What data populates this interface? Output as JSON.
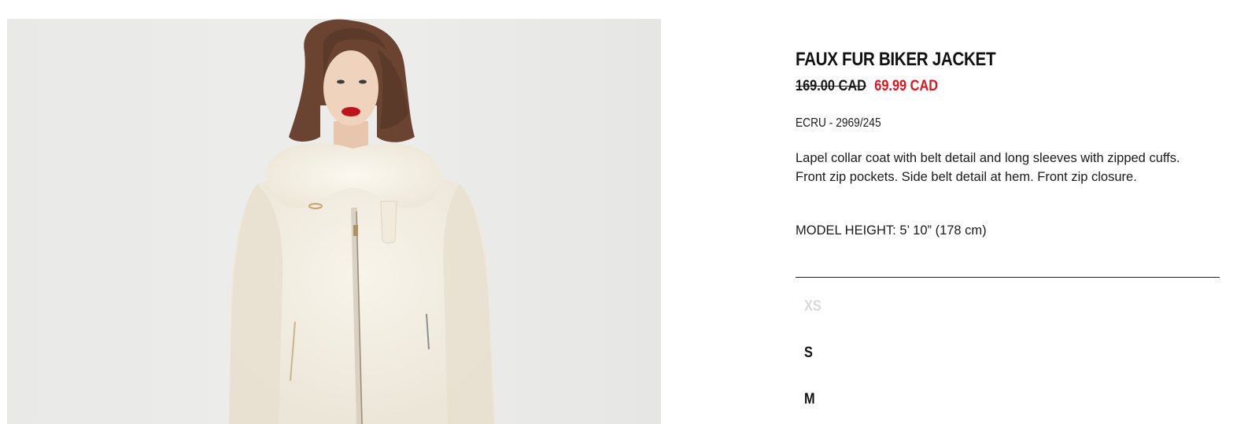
{
  "product": {
    "title": "FAUX FUR BIKER JACKET",
    "price_original": "169.00 CAD",
    "price_sale": "69.99 CAD",
    "color_ref": "ECRU - 2969/245",
    "description": "Lapel collar coat with belt detail and long sleeves with zipped cuffs. Front zip pockets. Side belt detail at hem. Front zip closure.",
    "model_height": "MODEL HEIGHT: 5’ 10” (178 cm)"
  },
  "sizes": [
    {
      "label": "XS",
      "available": false
    },
    {
      "label": "S",
      "available": true
    },
    {
      "label": "M",
      "available": true
    }
  ],
  "colors": {
    "sale_price": "#e3121b",
    "text": "#111111",
    "unavailable_size": "#d9d9d9",
    "photo_background": "#ececea"
  },
  "icons": {
    "product_photo": "model-wearing-ecru-faux-fur-jacket"
  }
}
